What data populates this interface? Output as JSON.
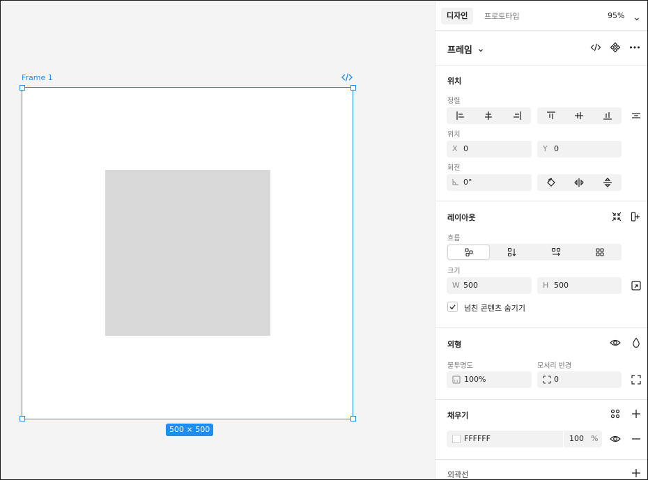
{
  "canvas": {
    "frame_label": "Frame 1",
    "size_badge": "500 × 500"
  },
  "header": {
    "tabs": [
      {
        "label": "디자인",
        "active": true
      },
      {
        "label": "프로토타입",
        "active": false
      }
    ],
    "zoom": "95%"
  },
  "frame_header": {
    "title": "프레임"
  },
  "position": {
    "title": "위치",
    "align_label": "정렬",
    "position_label": "위치",
    "x_key": "X",
    "x_value": "0",
    "y_key": "Y",
    "y_value": "0",
    "rotation_label": "회전",
    "rotation_value": "0°"
  },
  "layout": {
    "title": "레이아웃",
    "flow_label": "흐름",
    "size_label": "크기",
    "w_key": "W",
    "w_value": "500",
    "h_key": "H",
    "h_value": "500",
    "clip_content_label": "넘친 콘텐츠 숨기기",
    "clip_content_checked": true
  },
  "appearance": {
    "title": "외형",
    "opacity_label": "불투명도",
    "opacity_value": "100%",
    "radius_label": "모서리 반경",
    "radius_value": "0"
  },
  "fill": {
    "title": "채우기",
    "hex": "FFFFFF",
    "opacity": "100",
    "percent": "%"
  },
  "stroke": {
    "title": "외곽선"
  },
  "colors": {
    "accent": "#1e8df0",
    "inner_rect": "#d9d9d9",
    "frame_fill": "#ffffff"
  }
}
